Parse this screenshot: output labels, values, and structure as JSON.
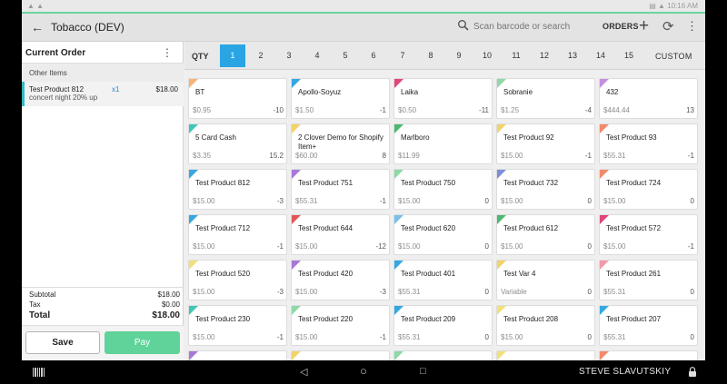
{
  "status": {
    "left": "▲ ▲",
    "right": "▤ ▲ 10:16 AM"
  },
  "header": {
    "back_icon": "arrow-back-icon",
    "title": "Tobacco (DEV)",
    "search_placeholder": "Scan barcode or search",
    "orders_label": "ORDERS"
  },
  "order": {
    "title": "Current Order",
    "section": "Other Items",
    "item": {
      "name": "Test Product 812",
      "modifier": "concert night 20% up",
      "qty": "x1",
      "price": "$18.00"
    },
    "subtotal_label": "Subtotal",
    "subtotal": "$18.00",
    "tax_label": "Tax",
    "tax": "$0.00",
    "total_label": "Total",
    "total": "$18.00",
    "save_label": "Save",
    "pay_label": "Pay"
  },
  "qty": {
    "label": "QTY",
    "numbers": [
      "1",
      "2",
      "3",
      "4",
      "5",
      "6",
      "7",
      "8",
      "9",
      "10",
      "11",
      "12",
      "13",
      "14",
      "15"
    ],
    "selected": "1",
    "custom_label": "CUSTOM"
  },
  "products": [
    {
      "name": "BT",
      "price": "$0.95",
      "count": "-10",
      "color": "#f4b47a"
    },
    {
      "name": "Apollo-Soyuz",
      "price": "$1.50",
      "count": "-1",
      "color": "#35a8e0"
    },
    {
      "name": "Laika",
      "price": "$0.50",
      "count": "-11",
      "color": "#e0457b"
    },
    {
      "name": "Sobranie",
      "price": "$1.25",
      "count": "-4",
      "color": "#8fd8a8"
    },
    {
      "name": "432",
      "price": "$444.44",
      "count": "13",
      "color": "#c58fe0"
    },
    {
      "name": "5 Card Cash",
      "price": "$3.35",
      "count": "15.2",
      "color": "#3fc7b5"
    },
    {
      "name": "2 Clover Demo for Shopify Item+",
      "price": "$60.00",
      "count": "8",
      "color": "#f2d36a"
    },
    {
      "name": "Marlboro",
      "price": "$11.99",
      "count": "",
      "color": "#4cb96e"
    },
    {
      "name": "Test Product 92",
      "price": "$15.00",
      "count": "-1",
      "color": "#f2d36a"
    },
    {
      "name": "Test Product 93",
      "price": "$55.31",
      "count": "-1",
      "color": "#f28a6a"
    },
    {
      "name": "Test Product 812",
      "price": "$15.00",
      "count": "-3",
      "color": "#35a8e0"
    },
    {
      "name": "Test Product 751",
      "price": "$55.31",
      "count": "-1",
      "color": "#a879d8"
    },
    {
      "name": "Test Product 750",
      "price": "$15.00",
      "count": "0",
      "color": "#8fd8a8"
    },
    {
      "name": "Test Product 732",
      "price": "$15.00",
      "count": "0",
      "color": "#7c8fd8"
    },
    {
      "name": "Test Product 724",
      "price": "$15.00",
      "count": "0",
      "color": "#f28a6a"
    },
    {
      "name": "Test Product 712",
      "price": "$15.00",
      "count": "-1",
      "color": "#35a8e0"
    },
    {
      "name": "Test Product 644",
      "price": "$15.00",
      "count": "-12",
      "color": "#e05757"
    },
    {
      "name": "Test Product 620",
      "price": "$15.00",
      "count": "0",
      "color": "#7cc0e8"
    },
    {
      "name": "Test Product 612",
      "price": "$15.00",
      "count": "0",
      "color": "#4cb96e"
    },
    {
      "name": "Test Product 572",
      "price": "$15.00",
      "count": "-1",
      "color": "#e0457b"
    },
    {
      "name": "Test Product 520",
      "price": "$15.00",
      "count": "-3",
      "color": "#f2e07a"
    },
    {
      "name": "Test Product 420",
      "price": "$15.00",
      "count": "-3",
      "color": "#a879d8"
    },
    {
      "name": "Test Product 401",
      "price": "$55.31",
      "count": "0",
      "color": "#35a8e0"
    },
    {
      "name": "Test Var 4",
      "price": "Variable",
      "count": "0",
      "color": "#f2d36a"
    },
    {
      "name": "Test Product 261",
      "price": "$55.31",
      "count": "0",
      "color": "#f29aa8"
    },
    {
      "name": "Test Product 230",
      "price": "$15.00",
      "count": "-1",
      "color": "#3fc7b5"
    },
    {
      "name": "Test Product 220",
      "price": "$15.00",
      "count": "-1",
      "color": "#8fd8a8"
    },
    {
      "name": "Test Product 209",
      "price": "$55.31",
      "count": "0",
      "color": "#35a8e0"
    },
    {
      "name": "Test Product 208",
      "price": "$15.00",
      "count": "0",
      "color": "#f2e07a"
    },
    {
      "name": "Test Product 207",
      "price": "$55.31",
      "count": "0",
      "color": "#35a8e0"
    },
    {
      "name": "",
      "price": "",
      "count": "",
      "color": "#a879d8"
    },
    {
      "name": "",
      "price": "",
      "count": "",
      "color": "#f2d36a"
    },
    {
      "name": "",
      "price": "",
      "count": "",
      "color": "#8fd8a8"
    },
    {
      "name": "",
      "price": "",
      "count": "",
      "color": "#f2e07a"
    },
    {
      "name": "",
      "price": "",
      "count": "",
      "color": "#f28a6a"
    }
  ],
  "navbar": {
    "user": "STEVE SLAVUTSKIY"
  }
}
